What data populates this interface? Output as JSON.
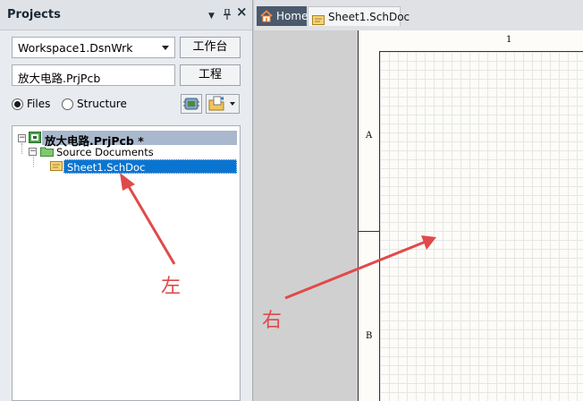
{
  "panel": {
    "title": "Projects",
    "controls": {
      "menu": "▼",
      "pin": "ᵖ",
      "close": "×"
    },
    "workspace_select": "Workspace1.DsnWrk",
    "workspace_button": "工作台",
    "project_field": "放大电路.PrjPcb",
    "project_button": "工程",
    "view_options": [
      {
        "label": "Files",
        "selected": true
      },
      {
        "label": "Structure",
        "selected": false
      }
    ]
  },
  "tree": {
    "project": {
      "name": "放大电路.PrjPcb *"
    },
    "folder": {
      "name": "Source Documents"
    },
    "document": {
      "name": "Sheet1.SchDoc",
      "selected": true
    }
  },
  "tabs": [
    {
      "label": "Home",
      "active": false
    },
    {
      "label": "Sheet1.SchDoc",
      "active": true
    }
  ],
  "sheet": {
    "col_label": "1",
    "row_labels": [
      "A",
      "B"
    ]
  },
  "annotations": {
    "left": "左",
    "right": "右",
    "color": "#e04a4a"
  },
  "colors": {
    "selection": "#0a75d1",
    "project_row": "#a9b8cc",
    "home_tab": "#4a5a6c"
  }
}
